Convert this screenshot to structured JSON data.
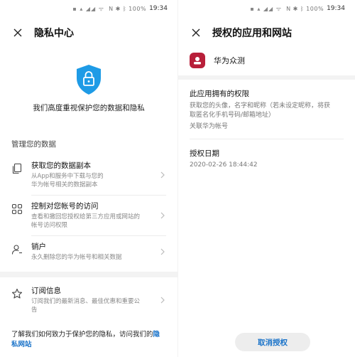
{
  "status": {
    "indicators": "N ✱ ᛒ 100%",
    "time": "19:34",
    "carrier_glyphs": "▪︎ ▴ ◢◢ ᯤ"
  },
  "left": {
    "title": "隐私中心",
    "tagline": "我们高度重视保护您的数据和隐私",
    "section_title": "管理您的数据",
    "items": [
      {
        "title": "获取您的数据副本",
        "subtitle_lines": [
          "从App和服务中下载与您的",
          "华为帐号相关的数据副本"
        ]
      },
      {
        "title": "控制对您帐号的访问",
        "subtitle_lines": [
          "查看和撤回您授权给第三方应用或网站的",
          "帐号访问权限"
        ]
      },
      {
        "title": "销户",
        "subtitle_lines": [
          "永久删除您的华为帐号和相关数据"
        ]
      },
      {
        "title": "订阅信息",
        "subtitle_lines": [
          "订阅我们的最新消息、最佳优惠和重要公",
          "告"
        ]
      }
    ],
    "footer_text": "了解我们如何致力于保护您的隐私，访问我们的",
    "footer_link": "隐私网站"
  },
  "right": {
    "title": "授权的应用和网站",
    "app_name": "华为众测",
    "perm_title": "此应用拥有的权限",
    "perm_desc_lines": [
      "获取您的头像，名字和昵称（若未设定昵称，将获",
      "取匿名化手机号码/邮箱地址）"
    ],
    "perm_link": "关联华为帐号",
    "date_label": "授权日期",
    "date_value": "2020-02-26 18:44:42",
    "revoke_label": "取消授权"
  },
  "colors": {
    "accent": "#1a73c9",
    "shield": "#1e9be6",
    "app_logo": "#b81f3a"
  }
}
